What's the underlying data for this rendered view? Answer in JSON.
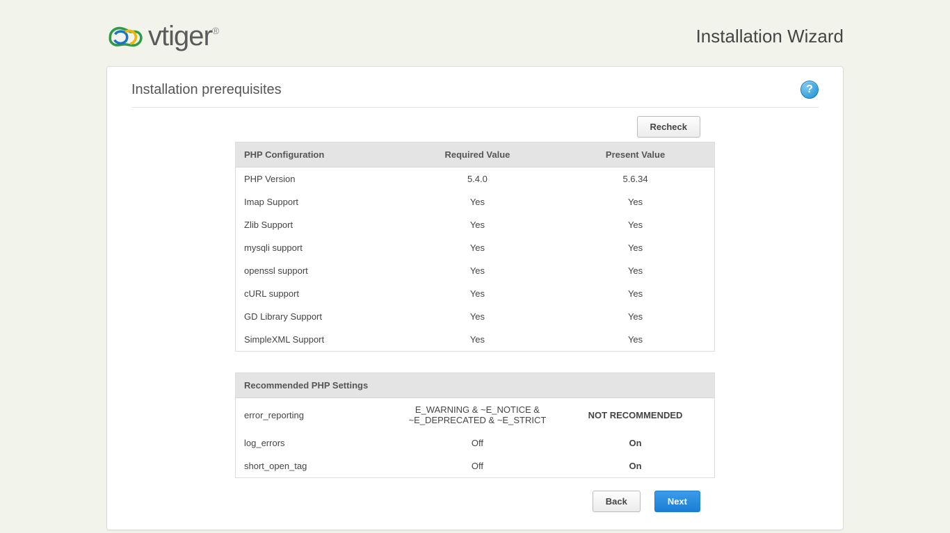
{
  "brand": "vtiger",
  "wizard_title": "Installation Wizard",
  "card_title": "Installation prerequisites",
  "help_glyph": "?",
  "buttons": {
    "recheck": "Recheck",
    "back": "Back",
    "next": "Next"
  },
  "table1": {
    "headers": [
      "PHP Configuration",
      "Required Value",
      "Present Value"
    ],
    "rows": [
      {
        "name": "PHP Version",
        "required": "5.4.0",
        "present": "5.6.34",
        "warn": false
      },
      {
        "name": "Imap Support",
        "required": "Yes",
        "present": "Yes",
        "warn": false
      },
      {
        "name": "Zlib Support",
        "required": "Yes",
        "present": "Yes",
        "warn": false
      },
      {
        "name": "mysqli support",
        "required": "Yes",
        "present": "Yes",
        "warn": false
      },
      {
        "name": "openssl support",
        "required": "Yes",
        "present": "Yes",
        "warn": false
      },
      {
        "name": "cURL support",
        "required": "Yes",
        "present": "Yes",
        "warn": false
      },
      {
        "name": "GD Library Support",
        "required": "Yes",
        "present": "Yes",
        "warn": false
      },
      {
        "name": "SimpleXML Support",
        "required": "Yes",
        "present": "Yes",
        "warn": false
      }
    ]
  },
  "table2": {
    "header": "Recommended PHP Settings",
    "rows": [
      {
        "name": "error_reporting",
        "required": "E_WARNING & ~E_NOTICE & ~E_DEPRECATED & ~E_STRICT",
        "present": "NOT RECOMMENDED",
        "warn": true
      },
      {
        "name": "log_errors",
        "required": "Off",
        "present": "On",
        "warn": true
      },
      {
        "name": "short_open_tag",
        "required": "Off",
        "present": "On",
        "warn": true
      }
    ]
  }
}
